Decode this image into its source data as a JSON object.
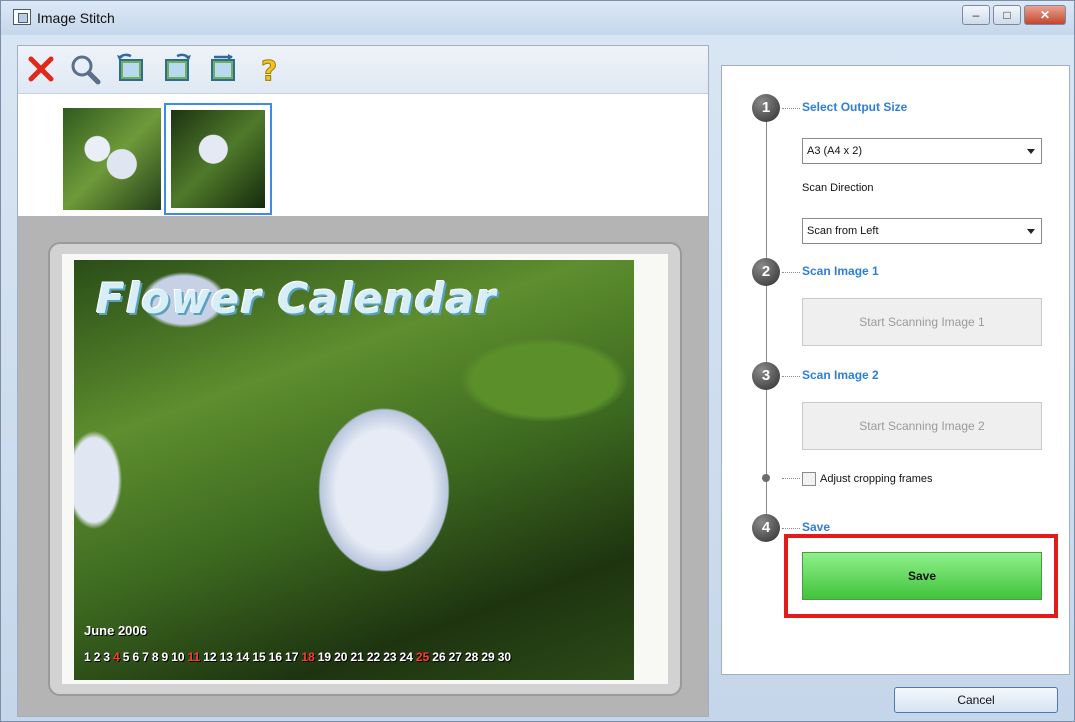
{
  "window": {
    "title": "Image Stitch",
    "controls": {
      "minimize": "–",
      "maximize": "□",
      "close": "✕"
    }
  },
  "toolbar": {
    "icons": [
      "delete-icon",
      "magnifier-icon",
      "rotate-left-icon",
      "rotate-right-icon",
      "swap-image-icon",
      "help-icon"
    ]
  },
  "thumbnails": {
    "selected_index": 1,
    "count": 2
  },
  "preview": {
    "title": "Flower Calendar",
    "month": "June 2006",
    "days": [
      "1",
      "2",
      "3",
      "4",
      "5",
      "6",
      "7",
      "8",
      "9",
      "10",
      "11",
      "12",
      "13",
      "14",
      "15",
      "16",
      "17",
      "18",
      "19",
      "20",
      "21",
      "22",
      "23",
      "24",
      "25",
      "26",
      "27",
      "28",
      "29",
      "30"
    ],
    "red_days": [
      "4",
      "11",
      "18",
      "25"
    ]
  },
  "steps": {
    "step1": {
      "number": "1",
      "title": "Select Output Size"
    },
    "output_size": "A3 (A4 x 2)",
    "scan_direction_label": "Scan Direction",
    "scan_direction": "Scan from Left",
    "step2": {
      "number": "2",
      "title": "Scan Image 1",
      "button": "Start Scanning Image 1"
    },
    "step3": {
      "number": "3",
      "title": "Scan Image 2",
      "button": "Start Scanning Image 2"
    },
    "adjust_cropping_label": "Adjust cropping frames",
    "step4": {
      "number": "4",
      "title": "Save",
      "button": "Save"
    }
  },
  "footer": {
    "cancel": "Cancel"
  },
  "colors": {
    "accent": "#2d7fd6",
    "highlight": "#e41b1b",
    "save_green": "#41c33c"
  }
}
